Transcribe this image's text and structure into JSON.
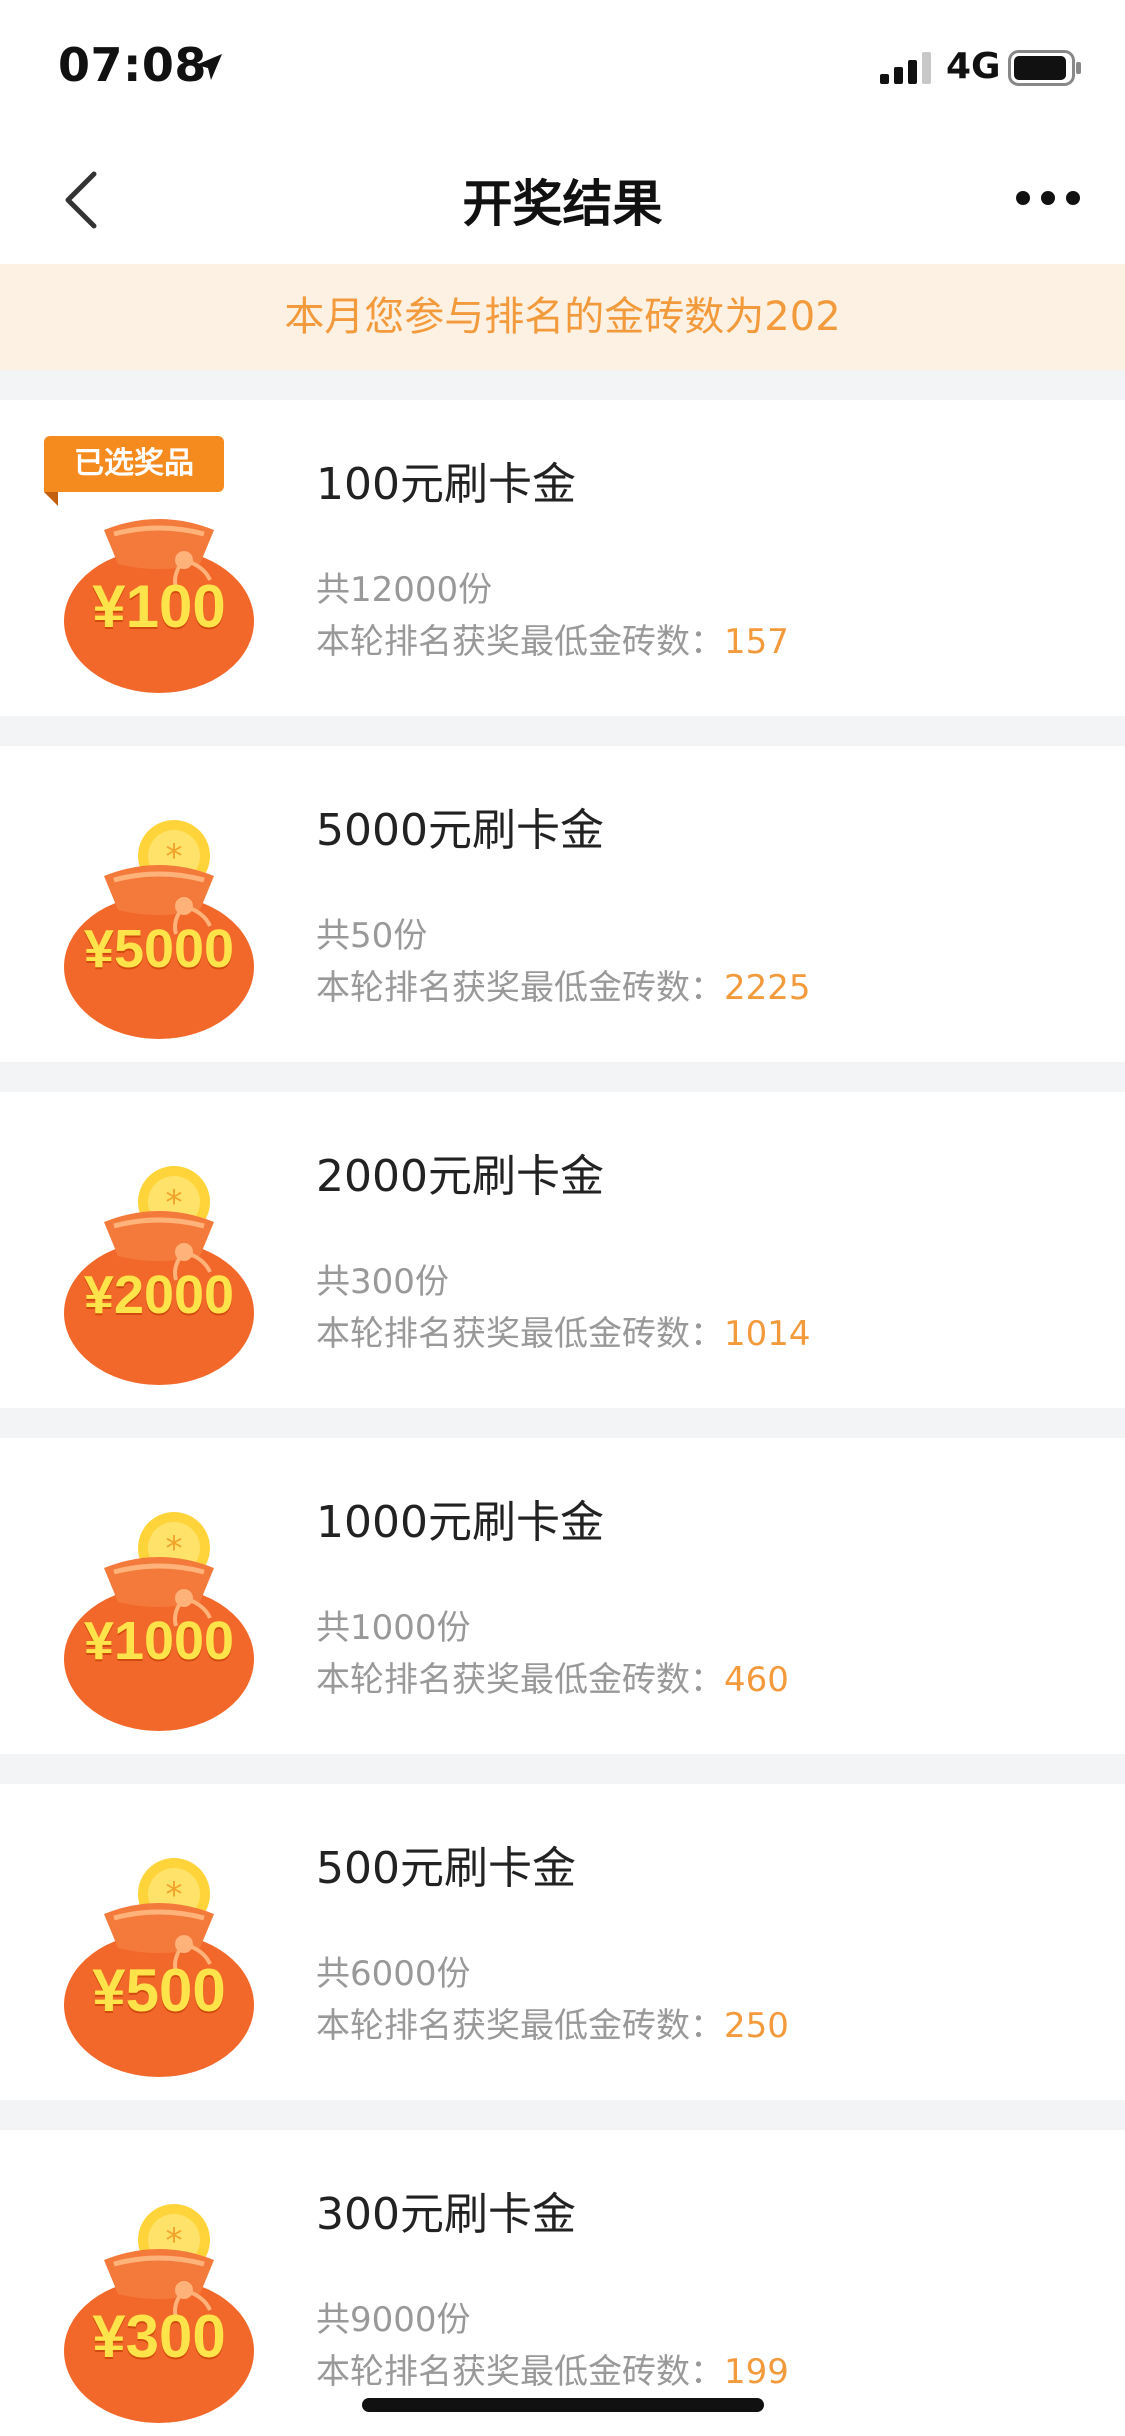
{
  "status_bar": {
    "time": "07:08",
    "network": "4G",
    "icons": [
      "location-arrow-icon",
      "signal-icon",
      "battery-icon"
    ]
  },
  "nav": {
    "title": "开奖结果",
    "icons": [
      "back-icon",
      "more-icon"
    ]
  },
  "notice": {
    "text": "本月您参与排名的金砖数为202"
  },
  "prizes": [
    {
      "bag_label": "¥100",
      "selected_tag": "已选奖品",
      "name": "100元刷卡金",
      "count": "共12000份",
      "min_label": "本轮排名获奖最低金砖数：",
      "min_value": "157"
    },
    {
      "bag_label": "¥5000",
      "name": "5000元刷卡金",
      "count": "共50份",
      "min_label": "本轮排名获奖最低金砖数：",
      "min_value": "2225"
    },
    {
      "bag_label": "¥2000",
      "name": "2000元刷卡金",
      "count": "共300份",
      "min_label": "本轮排名获奖最低金砖数：",
      "min_value": "1014"
    },
    {
      "bag_label": "¥1000",
      "name": "1000元刷卡金",
      "count": "共1000份",
      "min_label": "本轮排名获奖最低金砖数：",
      "min_value": "460"
    },
    {
      "bag_label": "¥500",
      "name": "500元刷卡金",
      "count": "共6000份",
      "min_label": "本轮排名获奖最低金砖数：",
      "min_value": "250"
    },
    {
      "bag_label": "¥300",
      "name": "300元刷卡金",
      "count": "共9000份",
      "min_label": "本轮排名获奖最低金砖数：",
      "min_value": "199"
    }
  ],
  "colors": {
    "accent": "#f39a3c",
    "notice_bg": "#fdf1e3",
    "bag": "#f2682a",
    "coin": "#ffd43b",
    "tag": "#f58a1f",
    "muted_text": "#999999"
  }
}
